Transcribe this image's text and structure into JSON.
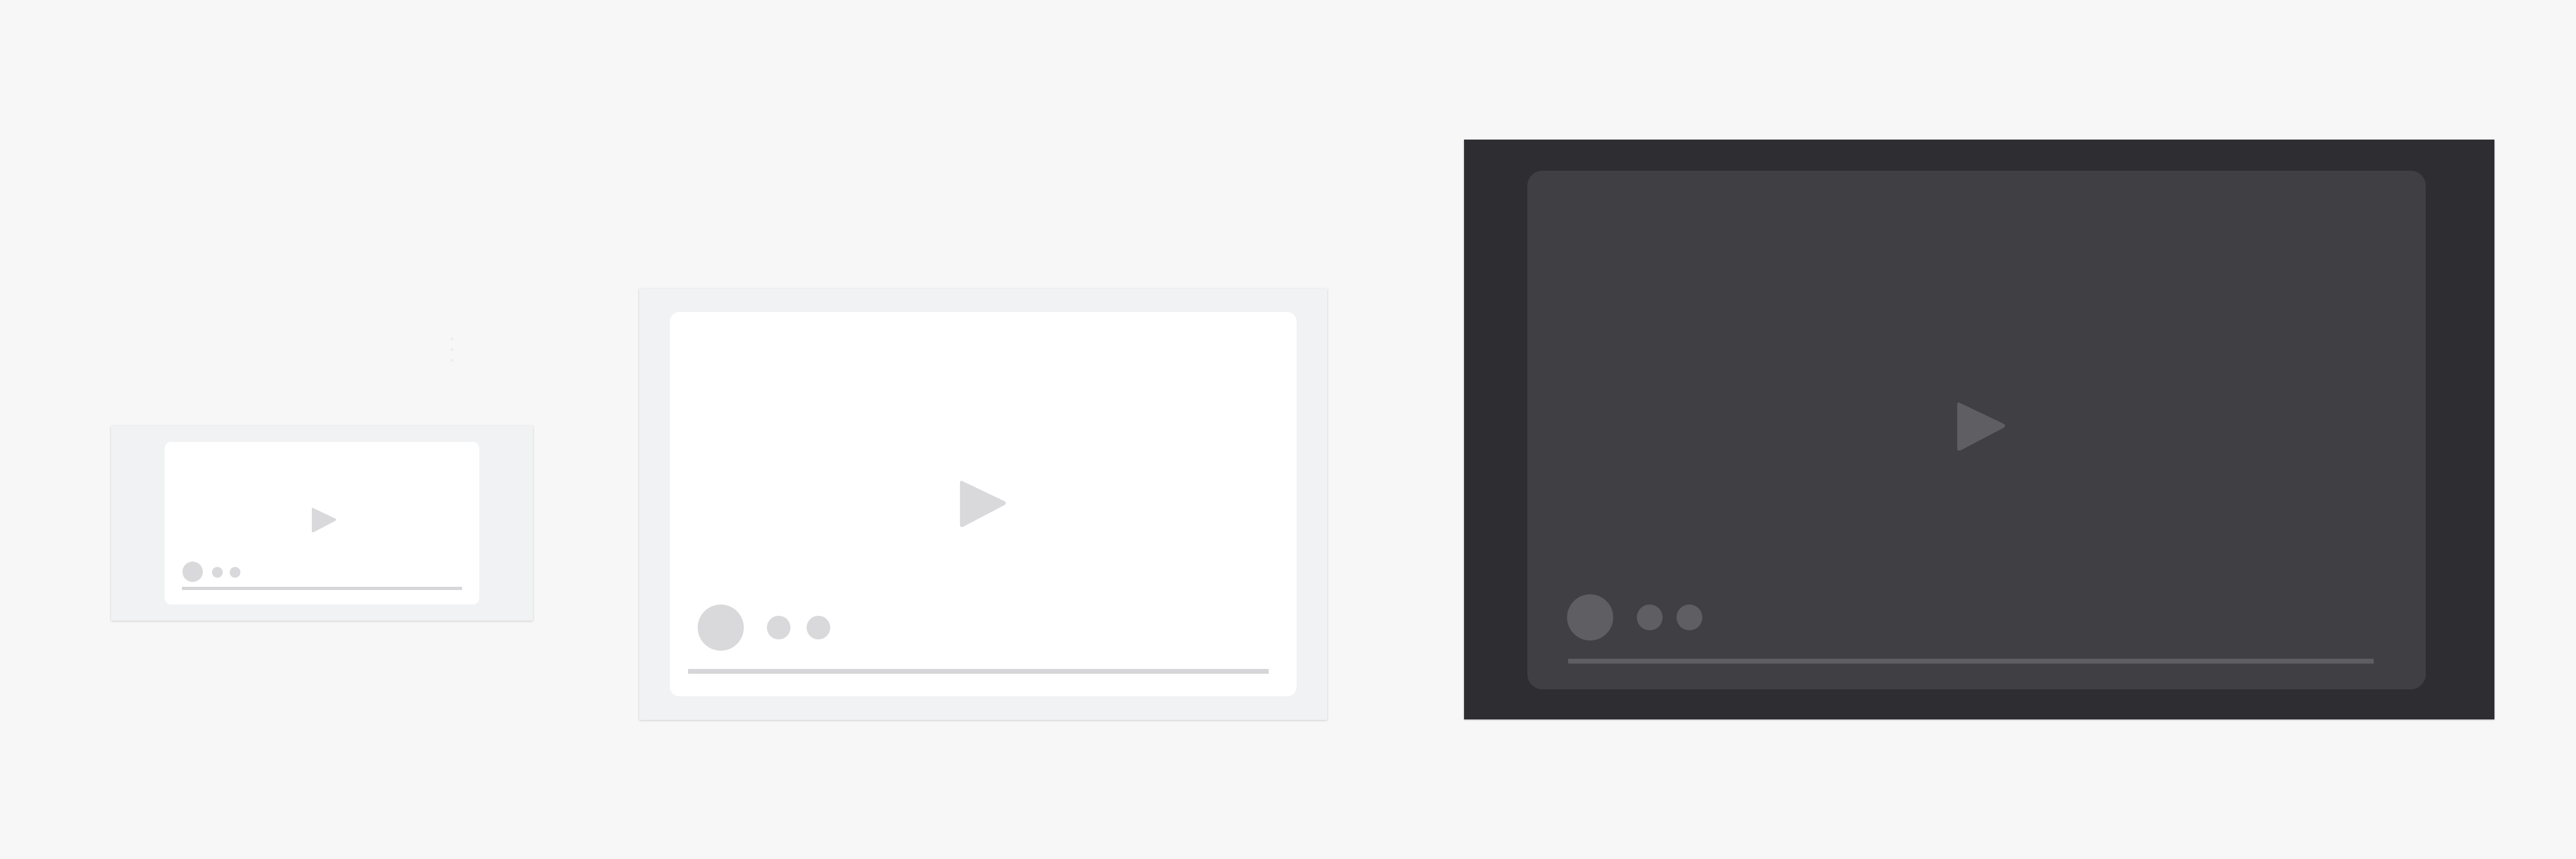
{
  "colors": {
    "page_background": "#f7f7f7",
    "light_frame": "#f1f2f4",
    "light_player": "#ffffff",
    "light_controls": "#d9d9db",
    "dark_frame": "#2e2d32",
    "dark_player": "#403f44",
    "dark_controls": "#5f5e63"
  },
  "frames": [
    {
      "id": "small",
      "theme": "light",
      "icon": "play-icon",
      "controls": [
        "play-control",
        "dot-control",
        "dot-control"
      ]
    },
    {
      "id": "medium",
      "theme": "light",
      "icon": "play-icon",
      "controls": [
        "play-control",
        "dot-control",
        "dot-control"
      ]
    },
    {
      "id": "large",
      "theme": "dark",
      "icon": "play-icon",
      "controls": [
        "play-control",
        "dot-control",
        "dot-control"
      ]
    }
  ],
  "progress": {
    "small": 0,
    "medium": 0,
    "large": 0
  }
}
